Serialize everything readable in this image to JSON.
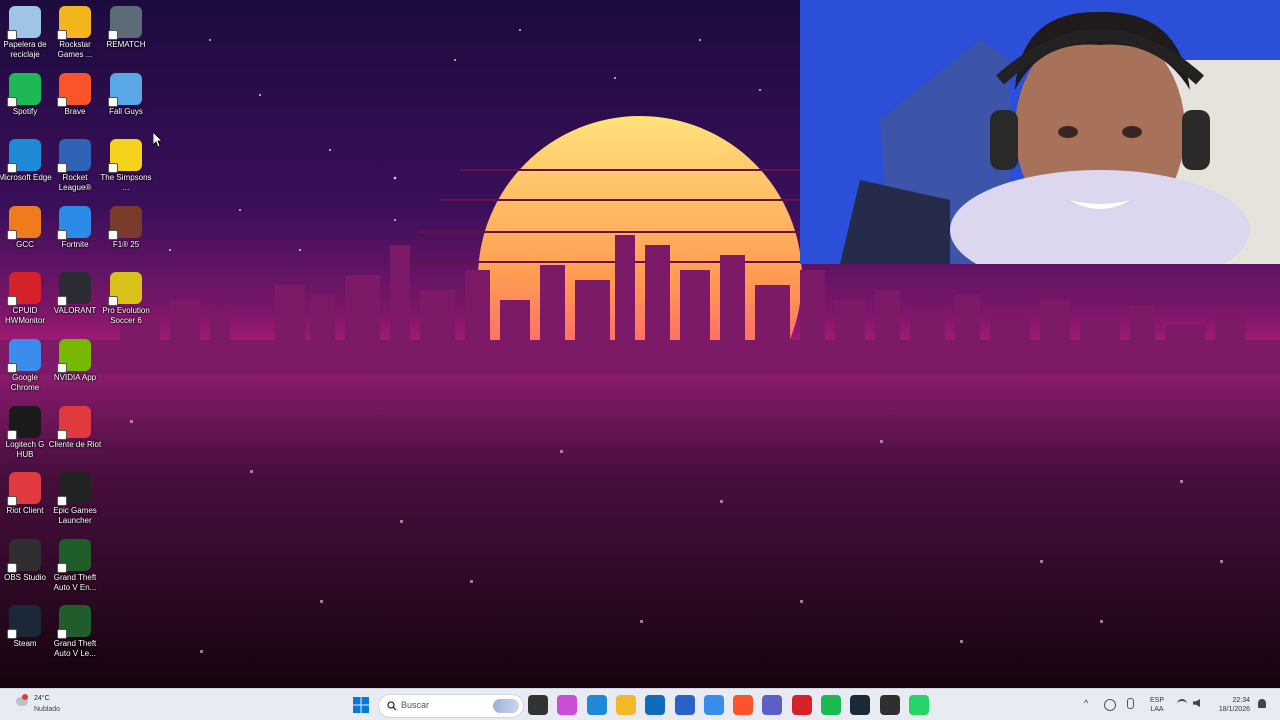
{
  "desktop_icons": [
    {
      "label": "Papelera de reciclaje",
      "icon": "recycle-bin-icon",
      "color": "#9fc4e8"
    },
    {
      "label": "Rockstar Games ...",
      "icon": "rockstar-icon",
      "color": "#f3b41c"
    },
    {
      "label": "REMATCH",
      "icon": "rematch-icon",
      "color": "#5d6b77"
    },
    {
      "label": "Spotify",
      "icon": "spotify-icon",
      "color": "#1db954"
    },
    {
      "label": "Brave",
      "icon": "brave-icon",
      "color": "#fb542b"
    },
    {
      "label": "Fall Guys",
      "icon": "fall-guys-icon",
      "color": "#5aa7e6"
    },
    {
      "label": "Microsoft Edge",
      "icon": "edge-icon",
      "color": "#1e8ad6"
    },
    {
      "label": "Rocket League®",
      "icon": "rocket-league-icon",
      "color": "#2f63b5"
    },
    {
      "label": "The Simpsons ...",
      "icon": "simpsons-icon",
      "color": "#f5d21c"
    },
    {
      "label": "GCC",
      "icon": "gcc-icon",
      "color": "#f07b1d"
    },
    {
      "label": "Fortnite",
      "icon": "fortnite-icon",
      "color": "#2c8be6"
    },
    {
      "label": "F1® 25",
      "icon": "f1-icon",
      "color": "#7a3b2a"
    },
    {
      "label": "CPUID HWMonitor",
      "icon": "hwmonitor-icon",
      "color": "#d5222a"
    },
    {
      "label": "VALORANT",
      "icon": "valorant-icon",
      "color": "#2b2b33"
    },
    {
      "label": "Pro Evolution Soccer 6",
      "icon": "pes-icon",
      "color": "#d9c21b"
    },
    {
      "label": "Google Chrome",
      "icon": "chrome-icon",
      "color": "#3b8ded"
    },
    {
      "label": "NVIDIA App",
      "icon": "nvidia-icon",
      "color": "#76b900"
    },
    {
      "label": "Logitech G HUB",
      "icon": "logitech-icon",
      "color": "#1a1a1a"
    },
    {
      "label": "Cliente de Riot",
      "icon": "riot-icon",
      "color": "#e03a3e"
    },
    {
      "label": "Riot Client",
      "icon": "riot-icon",
      "color": "#e03a3e"
    },
    {
      "label": "Epic Games Launcher",
      "icon": "epic-icon",
      "color": "#222222"
    },
    {
      "label": "OBS Studio",
      "icon": "obs-icon",
      "color": "#302e31"
    },
    {
      "label": "Grand Theft Auto V En...",
      "icon": "gta-icon",
      "color": "#1f5e2a"
    },
    {
      "label": "Steam",
      "icon": "steam-icon",
      "color": "#1b2838"
    },
    {
      "label": "Grand Theft Auto V Le...",
      "icon": "gta-icon",
      "color": "#1f5e2a"
    }
  ],
  "taskbar": {
    "weather_temp": "24°C",
    "weather_desc": "Nublado",
    "search_placeholder": "Buscar",
    "language_top": "ESP",
    "language_bottom": "LAA",
    "time": "22:34",
    "date": "18/1/2026"
  },
  "taskbar_apps": [
    {
      "icon": "task-view-icon",
      "color": "#333333"
    },
    {
      "icon": "copilot-icon",
      "color": "#c84ed6"
    },
    {
      "icon": "edge-icon",
      "color": "#1e8ad6"
    },
    {
      "icon": "file-explorer-icon",
      "color": "#f2b825"
    },
    {
      "icon": "outlook-icon",
      "color": "#0f6cbd"
    },
    {
      "icon": "store-icon",
      "color": "#2a62c9"
    },
    {
      "icon": "chrome-icon",
      "color": "#3b8ded"
    },
    {
      "icon": "brave-icon",
      "color": "#fb542b"
    },
    {
      "icon": "teams-icon",
      "color": "#5b5fc7"
    },
    {
      "icon": "hwmonitor-icon",
      "color": "#d5222a"
    },
    {
      "icon": "spotify-icon",
      "color": "#1db954"
    },
    {
      "icon": "steam-icon",
      "color": "#1b2838"
    },
    {
      "icon": "obs-icon",
      "color": "#302e31"
    },
    {
      "icon": "whatsapp-icon",
      "color": "#25d366"
    }
  ]
}
